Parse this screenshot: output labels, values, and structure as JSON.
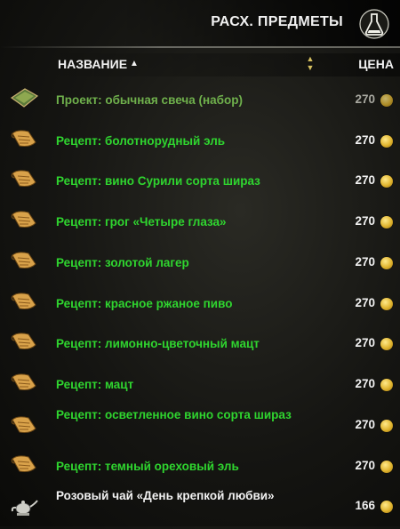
{
  "header": {
    "title": "РАСХ. ПРЕДМЕТЫ",
    "icon": "potion-flask-icon"
  },
  "columns": {
    "name_label": "НАЗВАНИЕ",
    "sort_indicator": "▲",
    "price_label": "ЦЕНА"
  },
  "items": [
    {
      "name": "Проект: обычная свеча (набор)",
      "price": "270",
      "icon": "blueprint-icon",
      "style": "dim"
    },
    {
      "name": "Рецепт: болотнорудный эль",
      "price": "270",
      "icon": "recipe-scroll-icon",
      "style": "green"
    },
    {
      "name": "Рецепт: вино Сурили сорта шираз",
      "price": "270",
      "icon": "recipe-scroll-icon",
      "style": "green"
    },
    {
      "name": "Рецепт: грог «Четыре глаза»",
      "price": "270",
      "icon": "recipe-scroll-icon",
      "style": "green"
    },
    {
      "name": "Рецепт: золотой лагер",
      "price": "270",
      "icon": "recipe-scroll-icon",
      "style": "green"
    },
    {
      "name": "Рецепт: красное ржаное пиво",
      "price": "270",
      "icon": "recipe-scroll-icon",
      "style": "green"
    },
    {
      "name": "Рецепт: лимонно-цветочный мацт",
      "price": "270",
      "icon": "recipe-scroll-icon",
      "style": "green"
    },
    {
      "name": "Рецепт: мацт",
      "price": "270",
      "icon": "recipe-scroll-icon",
      "style": "green"
    },
    {
      "name": "Рецепт: осветленное вино сорта шираз",
      "price": "270",
      "icon": "recipe-scroll-icon",
      "style": "green"
    },
    {
      "name": "Рецепт: темный ореховый эль",
      "price": "270",
      "icon": "recipe-scroll-icon",
      "style": "green"
    },
    {
      "name": "Розовый чай «День крепкой любви»",
      "price": "166",
      "icon": "teapot-icon",
      "style": "white"
    }
  ]
}
